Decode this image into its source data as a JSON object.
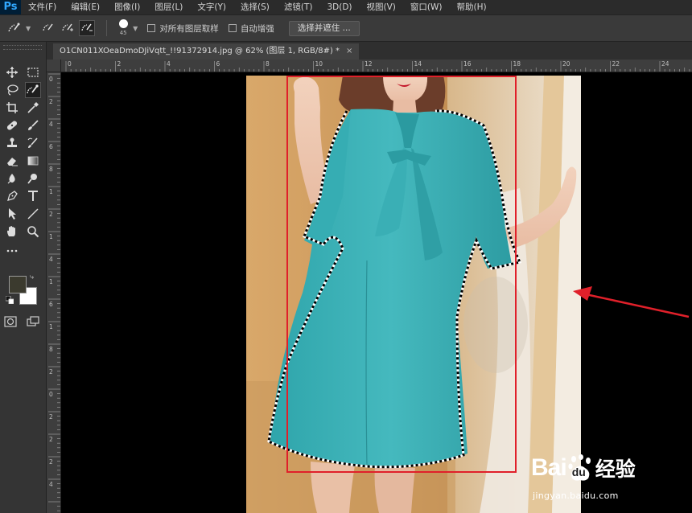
{
  "app": {
    "logo": "Ps",
    "menu": [
      "文件(F)",
      "编辑(E)",
      "图像(I)",
      "图层(L)",
      "文字(Y)",
      "选择(S)",
      "滤镜(T)",
      "3D(D)",
      "视图(V)",
      "窗口(W)",
      "帮助(H)"
    ]
  },
  "options": {
    "brush_size": "45",
    "sample_all_layers": "对所有图层取样",
    "auto_enhance": "自动增强",
    "select_and_mask": "选择并遮住 ..."
  },
  "document": {
    "tab_title": "O1CN011XOeaDmoDJiVqtt_!!91372914.jpg @ 62% (图层 1, RGB/8#) *",
    "close": "×"
  },
  "rulers": {
    "horizontal": [
      "0",
      "2",
      "4",
      "6",
      "8",
      "10",
      "12",
      "14",
      "16",
      "18",
      "20",
      "22",
      "24"
    ],
    "vertical": [
      "0",
      "2",
      "4",
      "6",
      "8",
      "1",
      "2",
      "1",
      "4",
      "1",
      "6",
      "1",
      "8",
      "2",
      "0",
      "2",
      "2",
      "2",
      "4"
    ]
  },
  "colors": {
    "foreground": "#3b3a2e",
    "background": "#ffffff",
    "annotation": "#e0202a",
    "dress": "#3fb3b8"
  },
  "watermark": {
    "brand_a": "Bai",
    "brand_b": "du",
    "brand_c": "经验",
    "url": "jingyan.baidu.com"
  },
  "icons": {
    "tools": [
      "move-icon",
      "marquee-icon",
      "lasso-icon",
      "quick-selection-icon",
      "crop-icon",
      "eyedropper-icon",
      "healing-icon",
      "brush-icon",
      "stamp-icon",
      "history-brush-icon",
      "eraser-icon",
      "gradient-icon",
      "blur-icon",
      "dodge-icon",
      "pen-icon",
      "type-icon",
      "path-selection-icon",
      "line-icon",
      "hand-icon",
      "zoom-icon",
      "more-tools-icon"
    ]
  }
}
